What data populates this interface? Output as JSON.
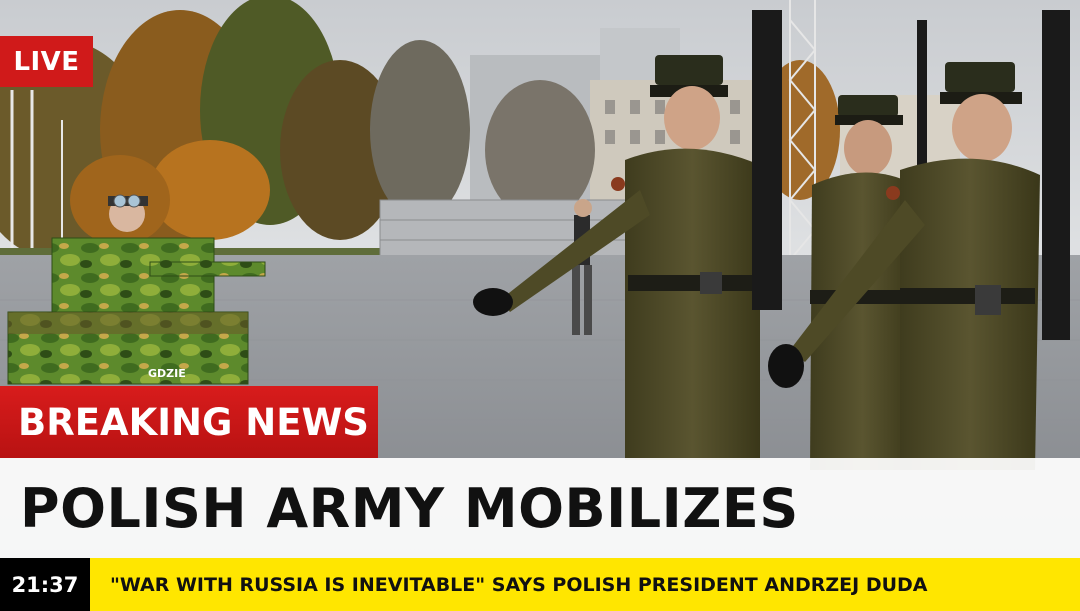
{
  "live_label": "LIVE",
  "breaking_label": "BREAKING NEWS",
  "headline": "POLISH ARMY MOBILIZES",
  "ticker": {
    "time": "21:37",
    "text": "\"WAR WITH RUSSIA IS INEVITABLE\" SAYS POLISH PRESIDENT ANDRZEJ DUDA"
  },
  "scene": {
    "tank_label": "GDZIE",
    "colors": {
      "live_red": "#d01a1a",
      "ticker_yellow": "#ffe600",
      "uniform_olive": "#4e4a26"
    }
  }
}
